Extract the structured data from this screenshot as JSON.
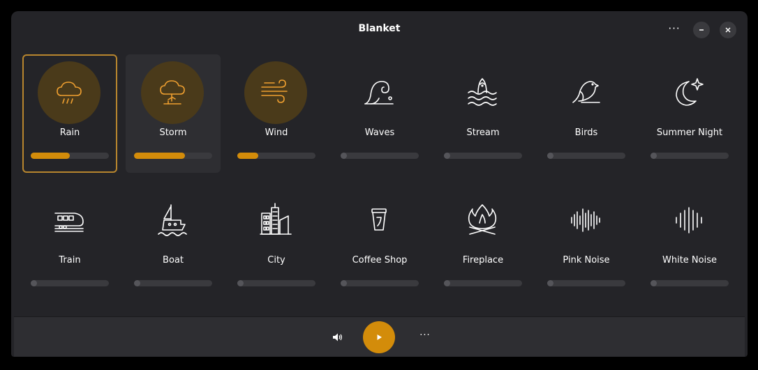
{
  "window": {
    "title": "Blanket",
    "menu_label": "···"
  },
  "sounds": [
    {
      "name": "Rain",
      "icon": "rain-cloud-icon",
      "active": true,
      "volume": 0.5,
      "selected": true
    },
    {
      "name": "Storm",
      "icon": "storm-cloud-icon",
      "active": true,
      "volume": 0.65,
      "hovered": true
    },
    {
      "name": "Wind",
      "icon": "wind-icon",
      "active": true,
      "volume": 0.27
    },
    {
      "name": "Waves",
      "icon": "wave-icon",
      "active": false,
      "volume": 0
    },
    {
      "name": "Stream",
      "icon": "fish-stream-icon",
      "active": false,
      "volume": 0
    },
    {
      "name": "Birds",
      "icon": "bird-icon",
      "active": false,
      "volume": 0
    },
    {
      "name": "Summer Night",
      "icon": "moon-star-icon",
      "active": false,
      "volume": 0
    },
    {
      "name": "Train",
      "icon": "train-icon",
      "active": false,
      "volume": 0
    },
    {
      "name": "Boat",
      "icon": "boat-icon",
      "active": false,
      "volume": 0
    },
    {
      "name": "City",
      "icon": "city-icon",
      "active": false,
      "volume": 0
    },
    {
      "name": "Coffee Shop",
      "icon": "coffee-cup-icon",
      "active": false,
      "volume": 0
    },
    {
      "name": "Fireplace",
      "icon": "fire-icon",
      "active": false,
      "volume": 0
    },
    {
      "name": "Pink Noise",
      "icon": "pink-noise-icon",
      "active": false,
      "volume": 0
    },
    {
      "name": "White Noise",
      "icon": "white-noise-icon",
      "active": false,
      "volume": 0
    }
  ],
  "bottombar": {
    "more_label": "···"
  },
  "colors": {
    "accent": "#d38c0a",
    "active_icon": "#f0a030",
    "inactive_icon": "#ffffff",
    "active_circle": "#4a3a1a",
    "selected_border": "#b8862e",
    "window_bg": "#242428"
  }
}
